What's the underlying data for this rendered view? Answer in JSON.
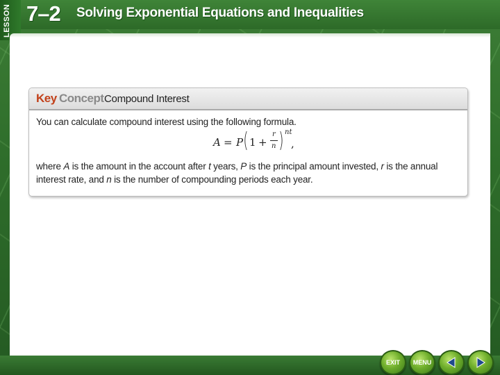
{
  "header": {
    "lesson_word": "LESSON",
    "lesson_number": "7–2",
    "title": "Solving Exponential Equations and Inequalities"
  },
  "key_concept": {
    "key": "Key",
    "concept": "Concept",
    "title": "Compound Interest",
    "intro": "You can calculate compound interest using the following formula.",
    "formula": {
      "lhs": "A",
      "equals": "=",
      "principal": "P",
      "one": "1",
      "plus": "+",
      "numerator": "r",
      "denominator": "n",
      "exponent": "nt",
      "comma": ","
    },
    "description": {
      "p1": "where ",
      "v1": "A",
      "p2": " is the amount in the account after ",
      "v2": "t",
      "p3": " years, ",
      "v3": "P",
      "p4": " is the principal amount invested, ",
      "v4": "r",
      "p5": " is the annual interest rate, and ",
      "v5": "n",
      "p6": " is the number of compounding periods each year."
    }
  },
  "nav": {
    "exit_label": "EXIT",
    "menu_label": "MENU",
    "prev_icon": "triangle-left-icon",
    "next_icon": "triangle-right-icon"
  },
  "colors": {
    "brand_green": "#2f6e2b",
    "key_orange": "#c2411a",
    "concept_gray": "#8a8a8a"
  }
}
